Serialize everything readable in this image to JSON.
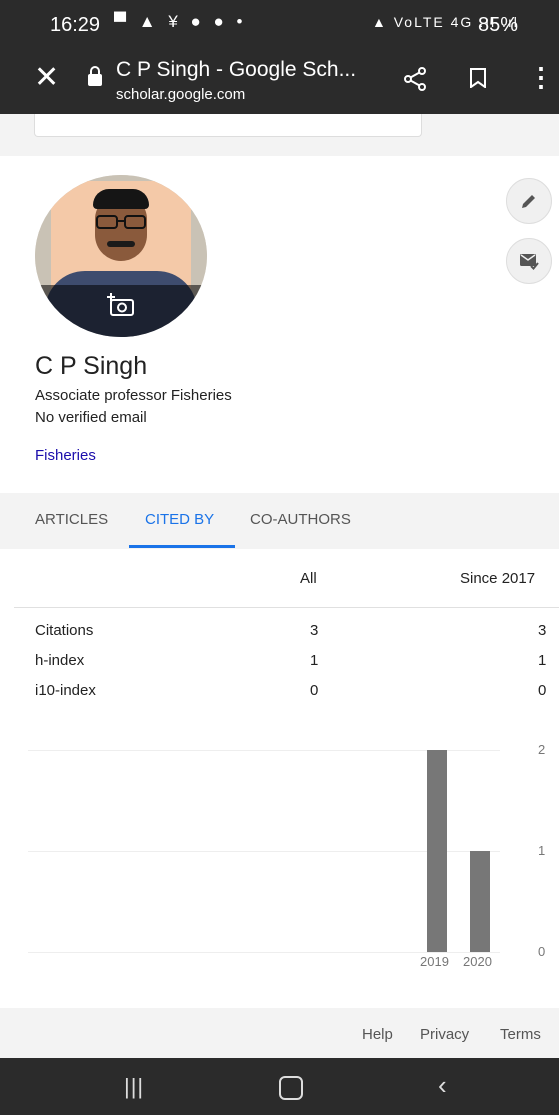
{
  "status_bar": {
    "time": "16:29",
    "left_icons": "▀ ▲ ¥ ● ●  •",
    "right_icons": "▲ VoLTE 4G .ıl .ıl",
    "battery": "85%"
  },
  "browser": {
    "title": "C P Singh - Google Sch...",
    "url": "scholar.google.com"
  },
  "profile": {
    "name": "C P Singh",
    "affiliation": "Associate professor Fisheries",
    "email_status": "No verified email",
    "interests": [
      "Fisheries"
    ]
  },
  "tabs": [
    {
      "label": "ARTICLES",
      "active": false
    },
    {
      "label": "CITED BY",
      "active": true
    },
    {
      "label": "CO-AUTHORS",
      "active": false
    }
  ],
  "citations": {
    "headers": {
      "all": "All",
      "since": "Since 2017"
    },
    "rows": [
      {
        "label": "Citations",
        "all": "3",
        "since": "3"
      },
      {
        "label": "h-index",
        "all": "1",
        "since": "1"
      },
      {
        "label": "i10-index",
        "all": "0",
        "since": "0"
      }
    ]
  },
  "chart_data": {
    "type": "bar",
    "categories": [
      "2019",
      "2020"
    ],
    "values": [
      2,
      1
    ],
    "ylim": [
      0,
      2
    ],
    "yticks": [
      "0",
      "1",
      "2"
    ],
    "grid": true,
    "color": "#777777"
  },
  "footer": {
    "help": "Help",
    "privacy": "Privacy",
    "terms": "Terms"
  },
  "colors": {
    "accent": "#1a73e8",
    "link": "#1a0dab",
    "bar": "#777777",
    "chrome": "#2b2b2b"
  }
}
